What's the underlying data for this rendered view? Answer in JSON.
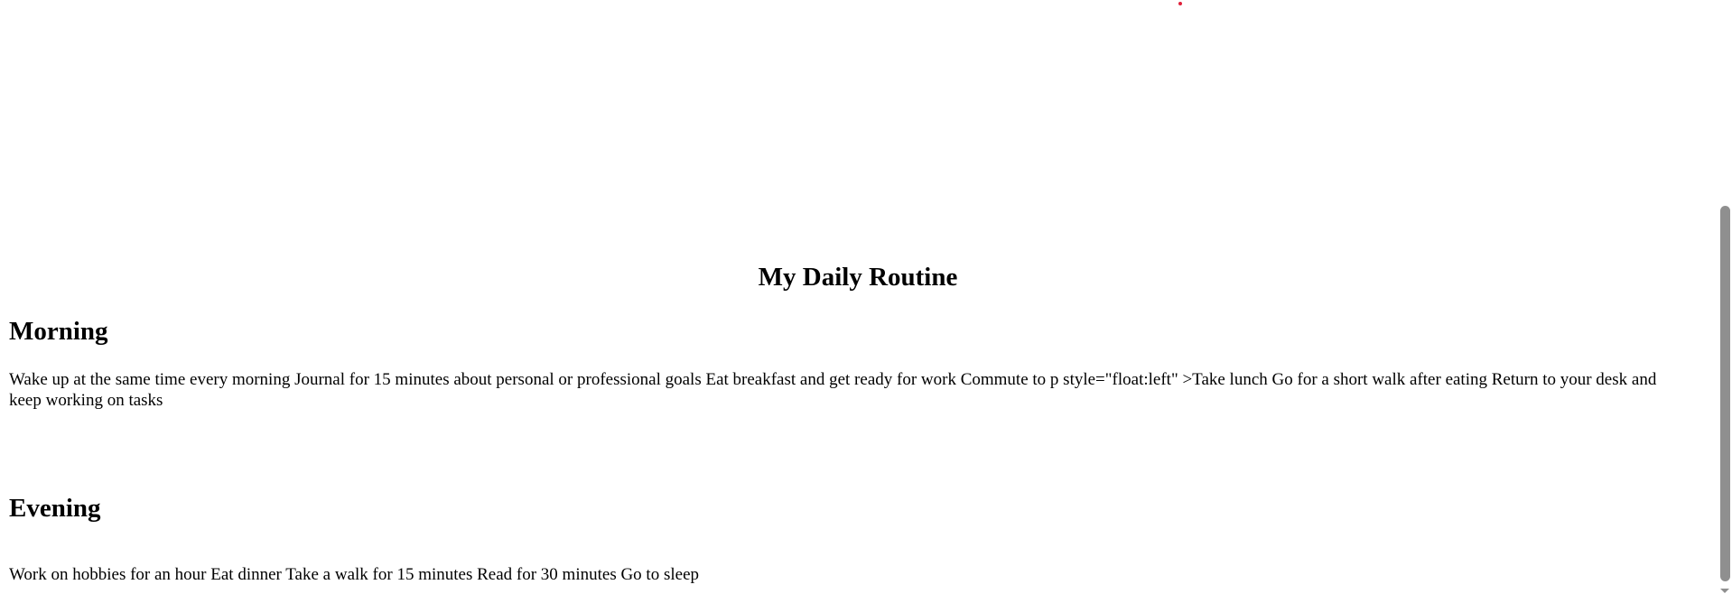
{
  "page": {
    "title": "My Daily Routine"
  },
  "sections": {
    "morning": {
      "heading": "Morning",
      "text": "Wake up at the same time every morning Journal for 15 minutes about personal or professional goals Eat breakfast and get ready for work Commute to p style=\"float:left\" >Take lunch Go for a short walk after eating Return to your desk and keep working on tasks"
    },
    "evening": {
      "heading": "Evening",
      "text": "Work on hobbies for an hour Eat dinner Take a walk for 15 minutes Read for 30 minutes Go to sleep"
    }
  },
  "icons": {
    "scroll_down": "chevron-down-icon"
  },
  "colors": {
    "dot": "#e0203a",
    "scrollbar_thumb": "#8f8f8f"
  }
}
